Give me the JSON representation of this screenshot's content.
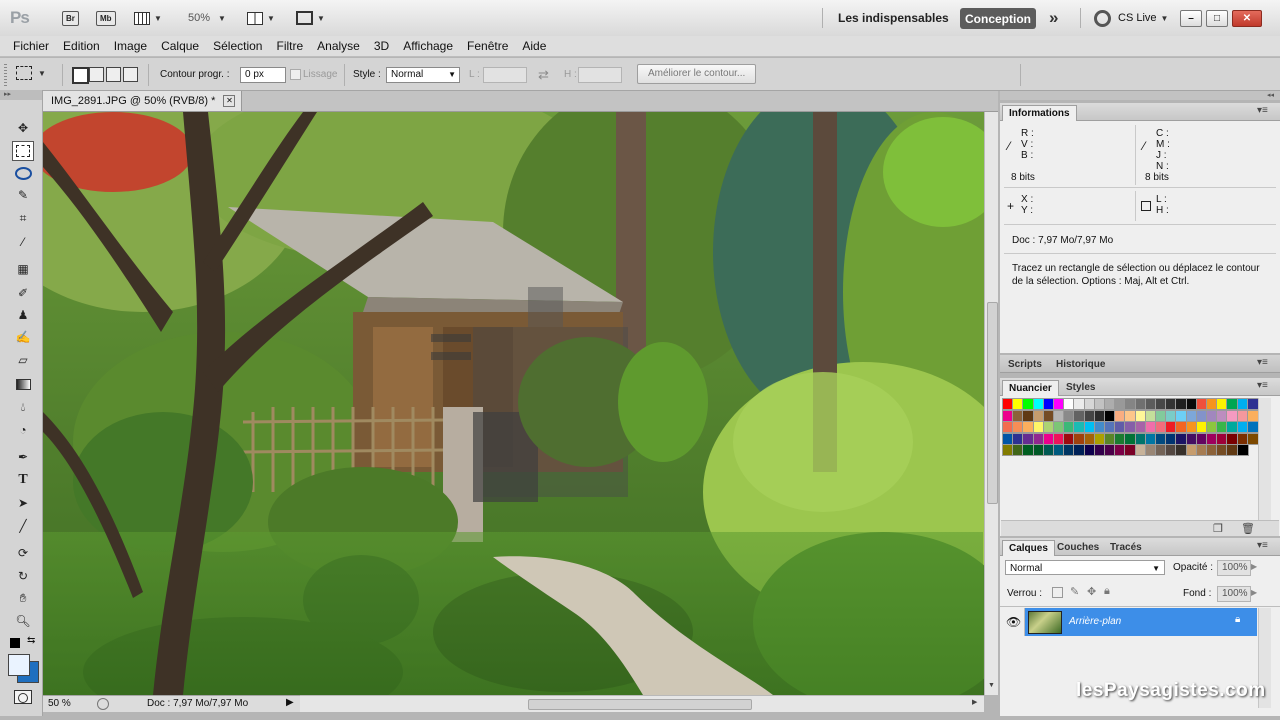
{
  "app": {
    "logo": "Ps",
    "zoom": "50%",
    "workspaces": [
      "Les indispensables",
      "Conception"
    ],
    "more": "»",
    "cslive": "CS Live",
    "window_controls": [
      "–",
      "□",
      "✕"
    ]
  },
  "appbar": {
    "btn_br": "Br",
    "btn_mb": "Mb"
  },
  "menu": [
    "Fichier",
    "Edition",
    "Image",
    "Calque",
    "Sélection",
    "Filtre",
    "Analyse",
    "3D",
    "Affichage",
    "Fenêtre",
    "Aide"
  ],
  "options": {
    "feather_label": "Contour progr. :",
    "feather_value": "0 px",
    "antialias_label": "Lissage",
    "style_label": "Style :",
    "style_value": "Normal",
    "width_label": "L :",
    "height_label": "H :",
    "refine_button": "Améliorer le contour..."
  },
  "document": {
    "tab_title": "IMG_2891.JPG @ 50% (RVB/8) *",
    "close": "✕",
    "status_zoom": "50 %",
    "status_doc": "Doc : 7,97 Mo/7,97 Mo"
  },
  "info_panel": {
    "tab": "Informations",
    "rgb_labels": [
      "R :",
      "V :",
      "B :"
    ],
    "cmyk_labels": [
      "C :",
      "M :",
      "J :",
      "N :"
    ],
    "bits_left": "8 bits",
    "bits_right": "8 bits",
    "xy_labels": [
      "X :",
      "Y :"
    ],
    "lh_labels": [
      "L :",
      "H :"
    ],
    "doc": "Doc : 7,97 Mo/7,97 Mo",
    "hint": "Tracez un rectangle de sélection ou déplacez le contour de la sélection. Options : Maj, Alt et Ctrl."
  },
  "scripts_panel": {
    "tabs": [
      "Scripts",
      "Historique"
    ]
  },
  "swatches_panel": {
    "tabs": [
      "Nuancier",
      "Styles"
    ],
    "rows": [
      [
        "#ff0000",
        "#ffff00",
        "#00ff00",
        "#00ffff",
        "#0000ff",
        "#ff00ff",
        "#ffffff",
        "#ebebeb",
        "#d6d6d6",
        "#c2c2c2",
        "#adadad",
        "#999999",
        "#858585",
        "#707070",
        "#5c5c5c",
        "#474747",
        "#333333",
        "#1f1f1f",
        "#0a0a0a",
        "#f0503c",
        "#f7941d",
        "#fff200",
        "#00a651",
        "#00aeef",
        "#2e3192"
      ],
      [
        "#ec008c",
        "#8c6239",
        "#603913",
        "#c69c6d",
        "#754c24",
        "#b5b5b5",
        "#8a8a8a",
        "#636363",
        "#454545",
        "#2b2b2b",
        "#000000",
        "#f9ad81",
        "#fdc68a",
        "#fff799",
        "#c4df9b",
        "#82ca9c",
        "#7accc8",
        "#6dcff6",
        "#7da7d9",
        "#8393ca",
        "#a187be",
        "#bc8dbf",
        "#f49ac1",
        "#f5989d",
        "#fbaf5d"
      ],
      [
        "#f26c4f",
        "#f68e56",
        "#fbaf5d",
        "#fff568",
        "#acd373",
        "#7cc576",
        "#3bb878",
        "#1abbb4",
        "#00bff3",
        "#438ccb",
        "#5574b9",
        "#605ca8",
        "#855fa8",
        "#a763a8",
        "#f06eaa",
        "#f26d7d",
        "#ed1c24",
        "#f26522",
        "#f7941d",
        "#fff200",
        "#8dc63f",
        "#39b54a",
        "#00a99d",
        "#00aeef",
        "#0072bc"
      ],
      [
        "#0054a6",
        "#2e3192",
        "#662d91",
        "#92278f",
        "#ec008c",
        "#ed145b",
        "#9e0b0f",
        "#a0410d",
        "#a36209",
        "#aba000",
        "#598527",
        "#1a7b30",
        "#007236",
        "#00746b",
        "#0076a3",
        "#004a80",
        "#003471",
        "#1b1464",
        "#440e62",
        "#630460",
        "#9e005d",
        "#9e0039",
        "#790000",
        "#7b2e00",
        "#7d4900"
      ],
      [
        "#827b00",
        "#406618",
        "#005e20",
        "#005826",
        "#005952",
        "#005b7f",
        "#003663",
        "#002157",
        "#0d004c",
        "#32004b",
        "#4b0049",
        "#7b0046",
        "#7a0026",
        "#c7b299",
        "#998675",
        "#736357",
        "#534741",
        "#37302a",
        "#c69c6d",
        "#a67c52",
        "#8c6239",
        "#754c24",
        "#603913",
        "#000000"
      ]
    ]
  },
  "layers_panel": {
    "tabs": [
      "Calques",
      "Couches",
      "Tracés"
    ],
    "blend_mode": "Normal",
    "opacity_label": "Opacité :",
    "opacity_value": "100%",
    "lock_label": "Verrou :",
    "fill_label": "Fond :",
    "fill_value": "100%",
    "layer_name": "Arrière-plan"
  },
  "watermark": "lesPaysagistes.com"
}
